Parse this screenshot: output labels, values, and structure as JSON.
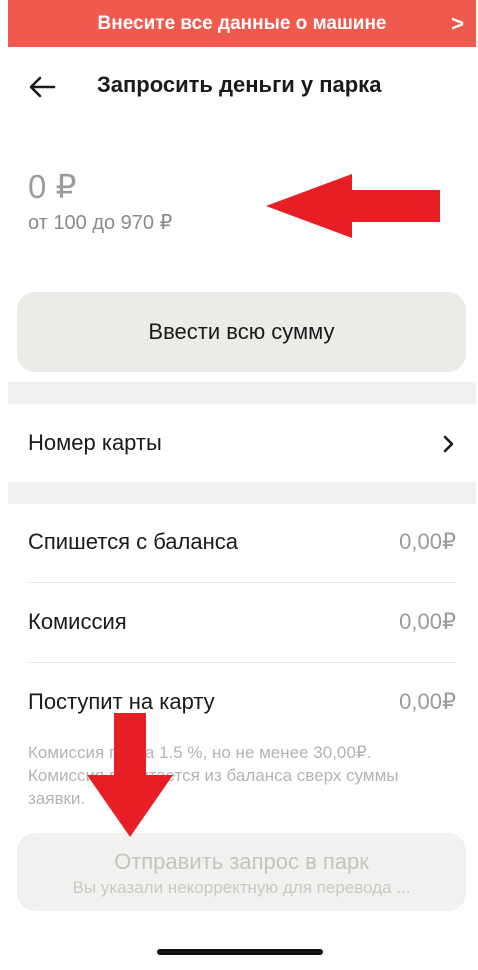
{
  "banner": {
    "text": "Внесите все данные о машине",
    "chevron": ">"
  },
  "header": {
    "title": "Запросить деньги у парка"
  },
  "amount": {
    "value": "0 ₽",
    "range": "от 100 до 970 ₽"
  },
  "full_amount_button": {
    "label": "Ввести всю сумму"
  },
  "card": {
    "label": "Номер карты"
  },
  "info_rows": [
    {
      "label": "Спишется с баланса",
      "value": "0,00₽"
    },
    {
      "label": "Комиссия",
      "value": "0,00₽"
    },
    {
      "label": "Поступит на карту",
      "value": "0,00₽"
    }
  ],
  "note": {
    "line1": "Комиссия парка 1.5 %, но не менее 30,00₽.",
    "line2": "Комиссия вычитается из баланса сверх суммы заявки."
  },
  "submit": {
    "label": "Отправить запрос в парк",
    "sublabel": "Вы указали некорректную для перевода ..."
  },
  "colors": {
    "accent": "#f05a4e",
    "annotation_red": "#e81e25",
    "muted": "#9b9b9b"
  },
  "icons": {
    "back": "arrow-left-icon",
    "card_chevron": "chevron-right-icon"
  }
}
